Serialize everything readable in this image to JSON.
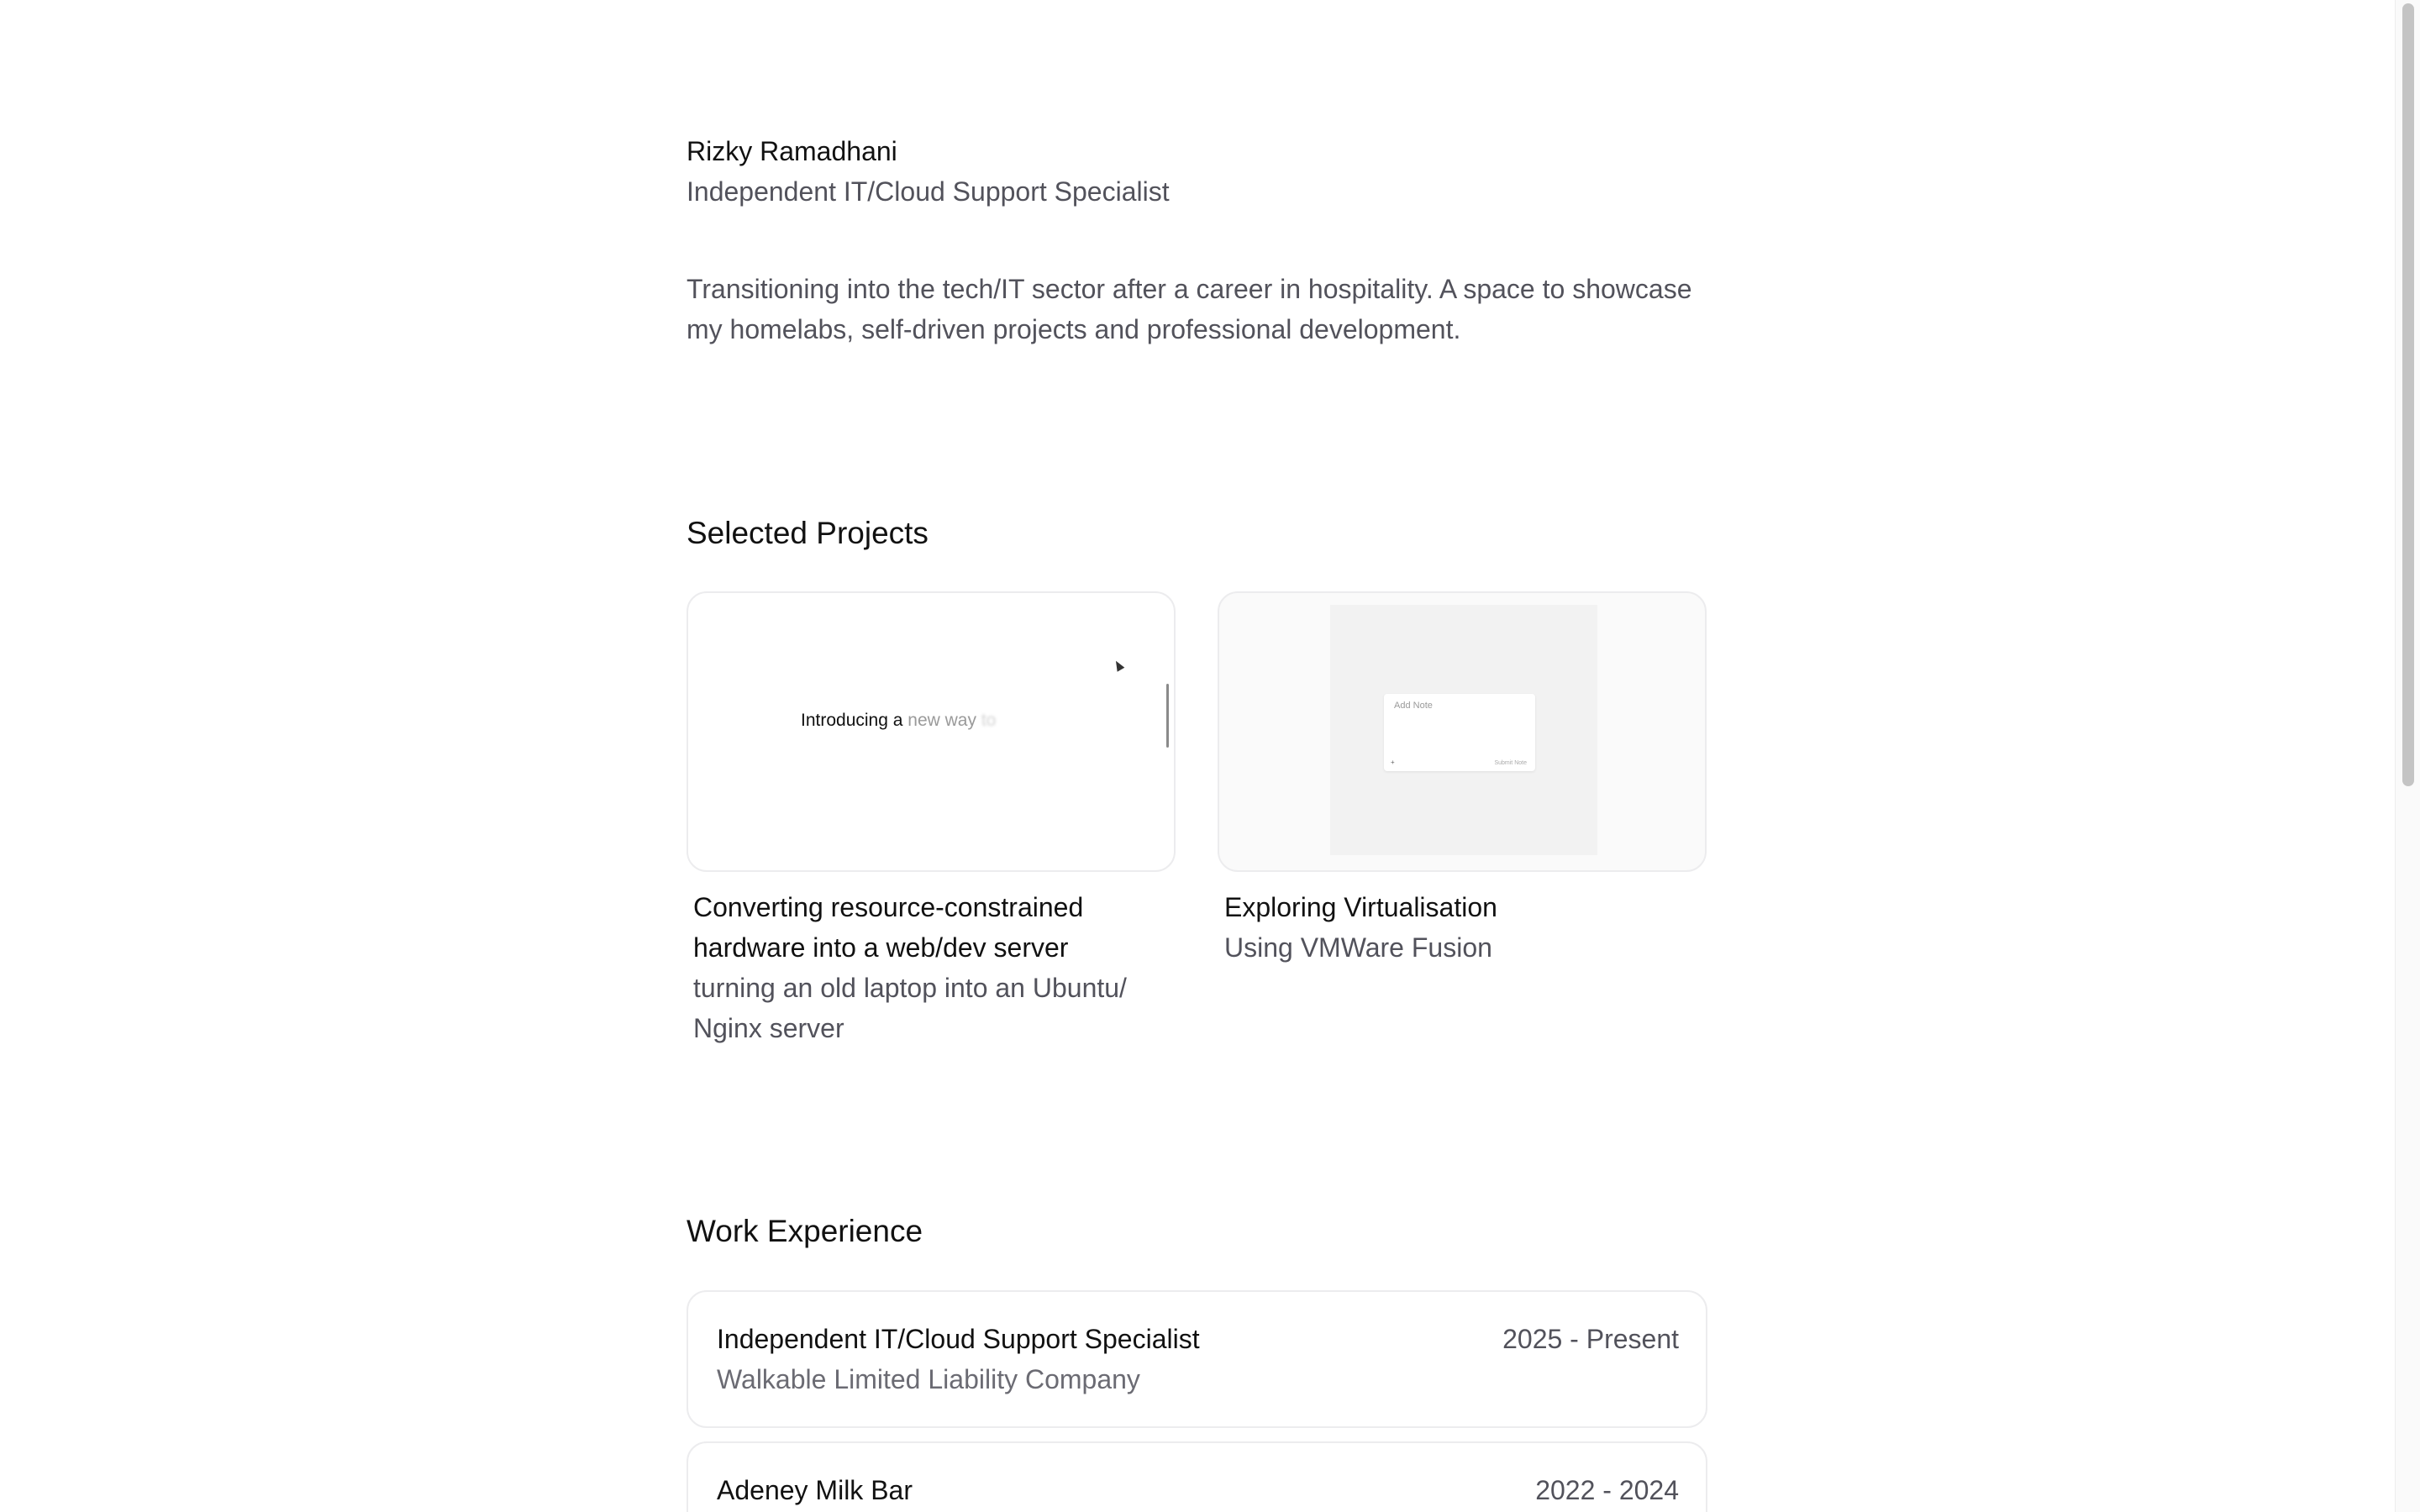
{
  "profile": {
    "name": "Rizky Ramadhani",
    "role": "Independent IT/Cloud Support Specialist",
    "bio": "Transitioning into the tech/IT sector after a career in hospitality. A space to showcase my homelabs, self-driven projects and professional development."
  },
  "projects": {
    "heading": "Selected Projects",
    "items": [
      {
        "title": "Converting resource-constrained hardware into a web/dev server",
        "subtitle": "turning an old laptop into an Ubuntu/ Nginx server",
        "preview": {
          "text_main": "Introducing a ",
          "text_fade1": "new way ",
          "text_fade2": "to"
        }
      },
      {
        "title": "Exploring Virtualisation",
        "subtitle": "Using VMWare Fusion",
        "preview": {
          "note_label": "Add Note",
          "note_plus": "+",
          "note_submit": "Submit Note"
        }
      }
    ]
  },
  "work": {
    "heading": "Work Experience",
    "items": [
      {
        "title": "Independent IT/Cloud Support Specialist",
        "company": "Walkable Limited Liability Company",
        "period": "2025 - Present"
      },
      {
        "title": "Adeney Milk Bar",
        "company": "",
        "period": "2022 - 2024"
      }
    ]
  },
  "colors": {
    "text_primary": "#111111",
    "text_secondary": "#52525b",
    "card_border": "#ececee"
  }
}
